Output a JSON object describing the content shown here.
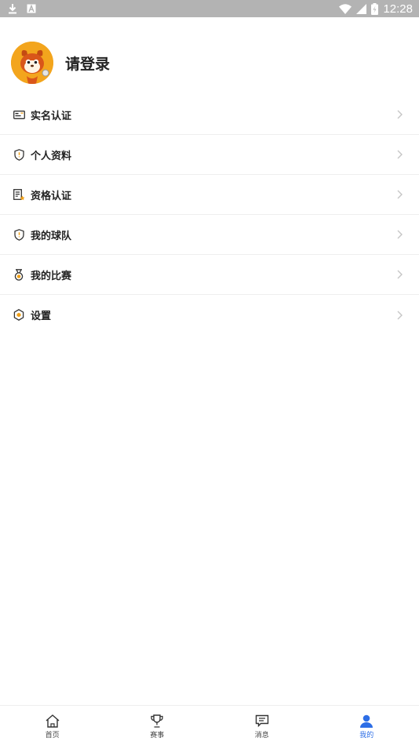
{
  "status_bar": {
    "time": "12:28",
    "left_icons": [
      "download-icon",
      "keyboard-a-icon"
    ],
    "right_icons": [
      "wifi-icon",
      "signal-icon",
      "battery-icon"
    ]
  },
  "profile": {
    "login_text": "请登录",
    "avatar": "squirrel-mascot-avatar"
  },
  "menu": {
    "items": [
      {
        "label": "实名认证",
        "icon": "id-card-icon"
      },
      {
        "label": "个人资料",
        "icon": "shield-info-icon"
      },
      {
        "label": "资格认证",
        "icon": "certificate-icon"
      },
      {
        "label": "我的球队",
        "icon": "shield-team-icon"
      },
      {
        "label": "我的比赛",
        "icon": "medal-icon"
      },
      {
        "label": "设置",
        "icon": "hexagon-settings-icon"
      }
    ]
  },
  "tabbar": {
    "tabs": [
      {
        "label": "首页",
        "icon": "home-icon",
        "active": false
      },
      {
        "label": "赛事",
        "icon": "trophy-icon",
        "active": false
      },
      {
        "label": "消息",
        "icon": "message-icon",
        "active": false
      },
      {
        "label": "我的",
        "icon": "person-icon",
        "active": true
      }
    ]
  },
  "colors": {
    "status_bar_bg": "#b3b3b3",
    "accent": "#2d6ee6",
    "icon_orange": "#f0a018"
  }
}
